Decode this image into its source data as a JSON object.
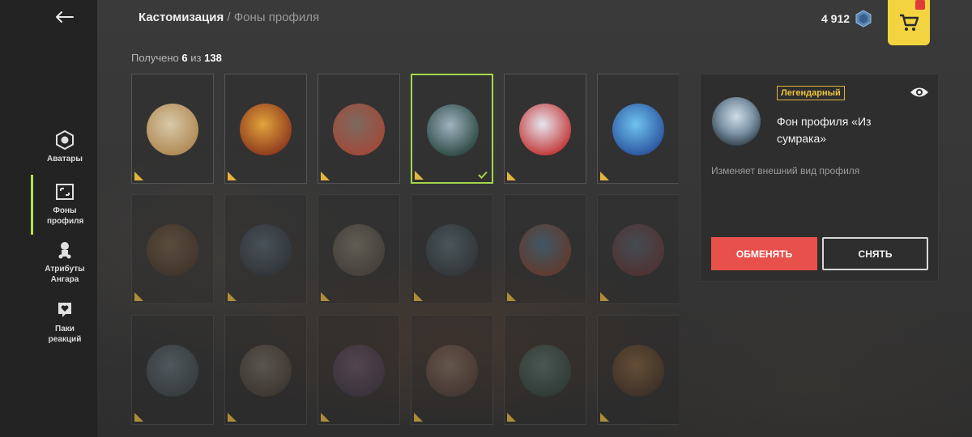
{
  "header": {
    "back_icon": "arrow-left-icon",
    "section": "Кастомизация",
    "separator": "/",
    "page": "Фоны профиля"
  },
  "counter": {
    "prefix": "Получено",
    "owned": "6",
    "middle": "из",
    "total": "138"
  },
  "currency": {
    "amount": "4 912",
    "icon": "gold-crystal-icon"
  },
  "shop": {
    "icon": "cart-icon",
    "badge_icon": "gift-badge-icon"
  },
  "sidebar": {
    "items": [
      {
        "label": "Аватары",
        "icon": "avatar-icon",
        "active": false
      },
      {
        "label": "Фоны профиля",
        "icon": "frame-icon",
        "active": true
      },
      {
        "label": "Атрибуты Ангара",
        "icon": "hangar-attributes-icon",
        "active": false
      },
      {
        "label": "Паки реакций",
        "icon": "reaction-heart-icon",
        "active": false
      }
    ]
  },
  "grid": {
    "items": [
      {
        "state": "owned",
        "colors": [
          "#d8c9a8",
          "#b08a55"
        ]
      },
      {
        "state": "owned",
        "colors": [
          "#e2a43a",
          "#8e3b1e"
        ]
      },
      {
        "state": "owned",
        "colors": [
          "#7c6a5e",
          "#a04a3a"
        ]
      },
      {
        "state": "selected",
        "colors": [
          "#9fb2bf",
          "#2f4a46"
        ]
      },
      {
        "state": "owned",
        "colors": [
          "#e6e6f0",
          "#c23a3a"
        ]
      },
      {
        "state": "owned",
        "colors": [
          "#6fc3f0",
          "#2c56a0"
        ]
      },
      {
        "state": "locked",
        "colors": [
          "#a07a50",
          "#5a3b22"
        ]
      },
      {
        "state": "locked",
        "colors": [
          "#6c8aa0",
          "#2e3c4a"
        ]
      },
      {
        "state": "locked",
        "colors": [
          "#b8ad95",
          "#6a6050"
        ]
      },
      {
        "state": "locked",
        "colors": [
          "#7a9aa8",
          "#334450"
        ]
      },
      {
        "state": "locked",
        "colors": [
          "#5aa0c8",
          "#b8502e"
        ]
      },
      {
        "state": "locked",
        "colors": [
          "#6a7e92",
          "#8a3a3a"
        ]
      },
      {
        "state": "locked",
        "colors": [
          "#8ea6b6",
          "#4a5a60"
        ]
      },
      {
        "state": "locked",
        "colors": [
          "#a89c8c",
          "#5e4a3c"
        ]
      },
      {
        "state": "locked",
        "colors": [
          "#8a6e8e",
          "#4e3a56"
        ]
      },
      {
        "state": "locked",
        "colors": [
          "#b89a86",
          "#6a4a3e"
        ]
      },
      {
        "state": "locked",
        "colors": [
          "#6ea29a",
          "#33524c"
        ]
      },
      {
        "state": "locked",
        "colors": [
          "#c28a48",
          "#5e3a1e"
        ]
      }
    ]
  },
  "panel": {
    "rarity": "Легендарный",
    "eye_icon": "eye-preview-icon",
    "title": "Фон профиля «Из сумрака»",
    "description": "Изменяет внешний вид профиля",
    "exchange_label": "ОБМЕНЯТЬ",
    "remove_label": "СНЯТЬ"
  },
  "colors": {
    "accent_green": "#a5d64a",
    "legendary_gold": "#e0b23a",
    "exchange_red": "#e8504c",
    "shop_yellow": "#f3d33f"
  }
}
